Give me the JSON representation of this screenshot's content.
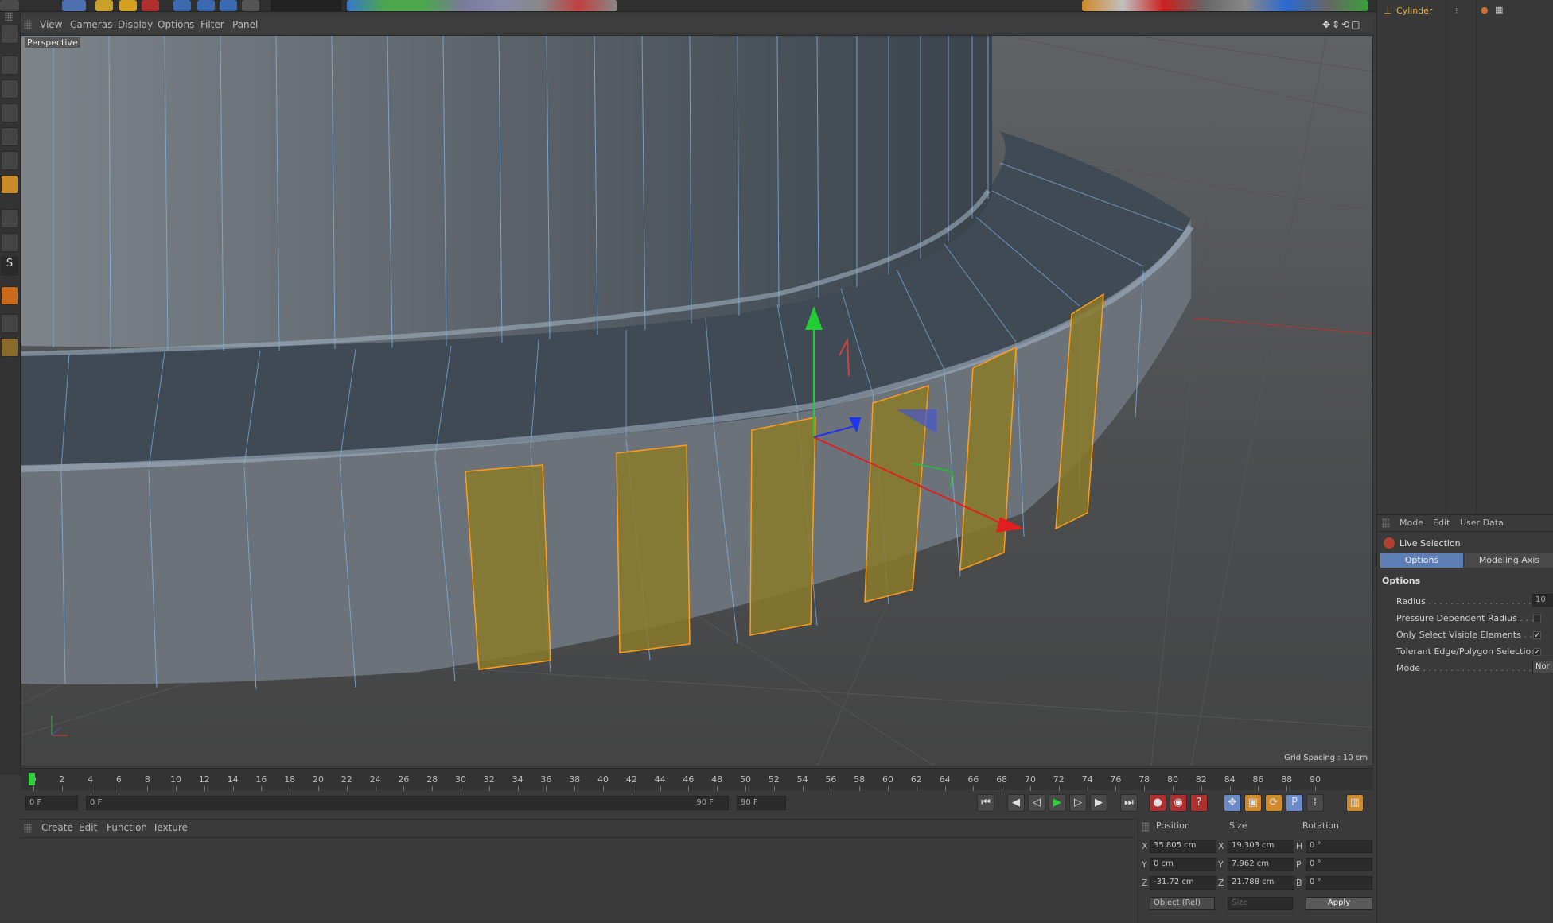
{
  "viewport": {
    "menu": [
      "View",
      "Cameras",
      "Display",
      "Options",
      "Filter",
      "Panel"
    ],
    "camera_label": "Perspective",
    "grid_spacing": "Grid Spacing : 10 cm"
  },
  "timeline": {
    "ticks": [
      "0",
      "2",
      "4",
      "6",
      "8",
      "10",
      "12",
      "14",
      "16",
      "18",
      "20",
      "22",
      "24",
      "26",
      "28",
      "30",
      "32",
      "34",
      "36",
      "38",
      "40",
      "42",
      "44",
      "46",
      "48",
      "50",
      "52",
      "54",
      "56",
      "58",
      "60",
      "62",
      "64",
      "66",
      "68",
      "70",
      "72",
      "74",
      "76",
      "78",
      "80",
      "82",
      "84",
      "86",
      "88",
      "90"
    ],
    "current_frame": "0 F",
    "range_start": "0 F",
    "range_end": "90 F",
    "end_frame": "90 F",
    "end_frame_right": "0 F"
  },
  "material_manager": {
    "menu": [
      "Create",
      "Edit",
      "Function",
      "Texture"
    ]
  },
  "coordinates": {
    "headers": {
      "position": "Position",
      "size": "Size",
      "rotation": "Rotation"
    },
    "rows": [
      {
        "axis": "X",
        "pos": "35.805 cm",
        "size_axis": "X",
        "size": "19.303 cm",
        "rot_axis": "H",
        "rot": "0 °"
      },
      {
        "axis": "Y",
        "pos": "0 cm",
        "size_axis": "Y",
        "size": "7.962 cm",
        "rot_axis": "P",
        "rot": "0 °"
      },
      {
        "axis": "Z",
        "pos": "-31.72 cm",
        "size_axis": "Z",
        "size": "21.788 cm",
        "rot_axis": "B",
        "rot": "0 °"
      }
    ],
    "mode_select": "Object (Rel)",
    "size_select": "Size",
    "apply_label": "Apply"
  },
  "object_manager": {
    "object_name": "Cylinder"
  },
  "attribute_manager": {
    "menu": [
      "Mode",
      "Edit",
      "User Data"
    ],
    "tool_name": "Live Selection",
    "tabs": [
      "Options",
      "Modeling Axis"
    ],
    "section": "Options",
    "fields": [
      {
        "label": "Radius",
        "value": "10"
      },
      {
        "label": "Pressure Dependent Radius",
        "value": ""
      },
      {
        "label": "Only Select Visible Elements",
        "value": "✓"
      },
      {
        "label": "Tolerant Edge/Polygon Selection",
        "value": "✓"
      },
      {
        "label": "Mode",
        "value": "Nor"
      }
    ]
  },
  "colors": {
    "wire": "#7fb2e6",
    "selected_poly": "#8a7a2a",
    "selected_edge": "#ff9d1a",
    "axis_x": "#e02020",
    "axis_y": "#22cc33",
    "axis_z": "#2233ee"
  }
}
